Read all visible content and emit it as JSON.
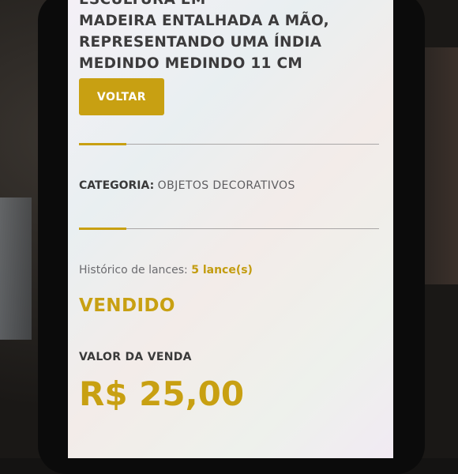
{
  "product": {
    "title_lines": [
      "ESCULTURA EM",
      "MADEIRA ENTALHADA A MÃO,",
      "REPRESENTANDO UMA ÍNDIA",
      "MEDINDO MEDINDO 11 CM"
    ]
  },
  "actions": {
    "back_label": "VOLTAR"
  },
  "category": {
    "label": "CATEGORIA:",
    "value": "OBJETOS DECORATIVOS"
  },
  "bids": {
    "label": "Histórico de lances:",
    "count": "5 lance(s)"
  },
  "status": {
    "label": "VENDIDO"
  },
  "sale": {
    "label": "VALOR DA VENDA",
    "value": "R$ 25,00"
  },
  "colors": {
    "accent": "#c8a012",
    "text_dark": "#3c3b3c",
    "text_muted": "#6b6b6f"
  }
}
